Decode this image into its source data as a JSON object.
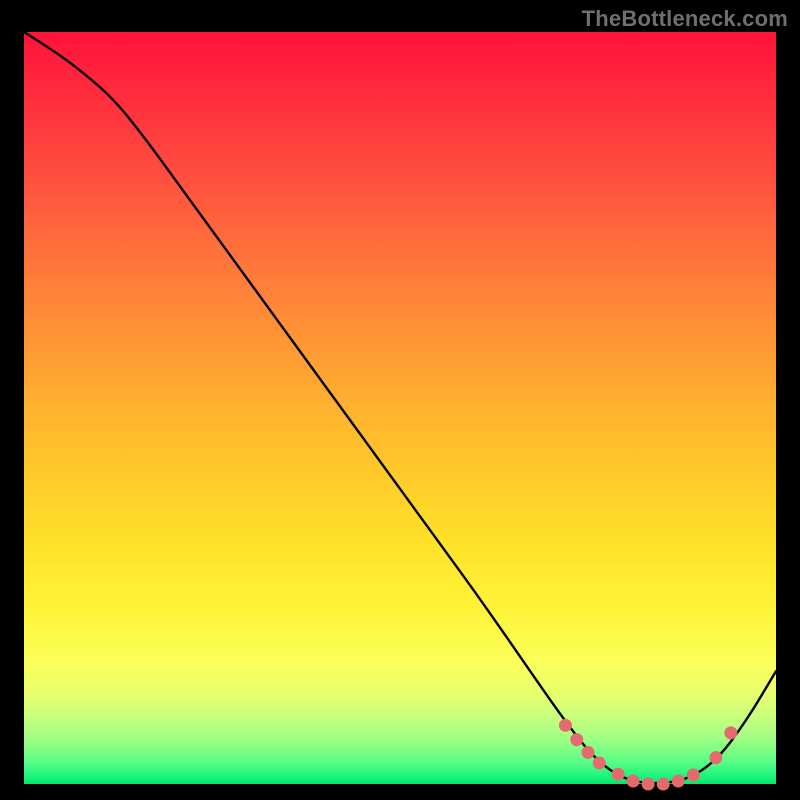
{
  "watermark": "TheBottleneck.com",
  "colors": {
    "background": "#000000",
    "gradient_top": "#ff133a",
    "gradient_bottom": "#06e46b",
    "curve": "#000000",
    "marker": "#e46a6e"
  },
  "chart_data": {
    "type": "line",
    "title": "",
    "xlabel": "",
    "ylabel": "",
    "xlim": [
      0,
      100
    ],
    "ylim": [
      0,
      100
    ],
    "x": [
      0,
      4,
      8,
      12,
      16,
      20,
      24,
      28,
      32,
      36,
      40,
      44,
      48,
      52,
      56,
      60,
      64,
      68,
      72,
      76,
      80,
      84,
      88,
      92,
      96,
      100
    ],
    "values": [
      100,
      97.5,
      94.5,
      91,
      86,
      80.5,
      75,
      69.5,
      64,
      58.5,
      53,
      47.5,
      42,
      36.5,
      31,
      25.5,
      19.8,
      14,
      8.3,
      3.2,
      0.5,
      0,
      0.5,
      3,
      8.3,
      15
    ],
    "markers": {
      "x": [
        72,
        73.5,
        75,
        76.5,
        79,
        81,
        83,
        85,
        87,
        89,
        92,
        94
      ],
      "y": [
        7.8,
        5.9,
        4.2,
        2.8,
        1.3,
        0.4,
        0,
        0,
        0.4,
        1.2,
        3.5,
        6.8
      ]
    }
  }
}
